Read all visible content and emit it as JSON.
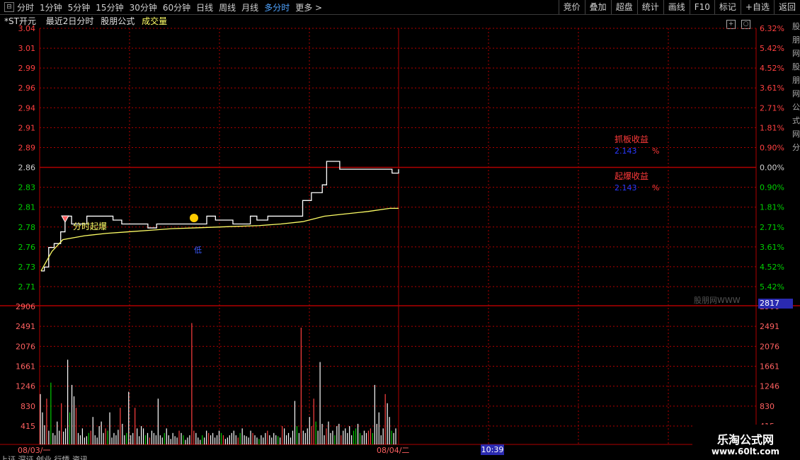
{
  "toolbar": {
    "close_glyph": "⊟",
    "tabs": [
      "分时",
      "1分钟",
      "5分钟",
      "15分钟",
      "30分钟",
      "60分钟",
      "日线",
      "周线",
      "月线",
      "多分时",
      "更多 >"
    ],
    "active_tab": "多分时",
    "right_buttons": [
      "竞价",
      "叠加",
      "超盘",
      "统计",
      "画线",
      "F10",
      "标记",
      "+自选",
      "返回"
    ]
  },
  "info": {
    "stock": "*ST开元",
    "period": "最近2日分时",
    "formula": "股朋公式",
    "volume_label": "成交量"
  },
  "price_axis": {
    "left": [
      "3.04",
      "3.01",
      "2.99",
      "2.96",
      "2.94",
      "2.91",
      "2.89",
      "2.86",
      "2.83",
      "2.81",
      "2.78",
      "2.76",
      "2.73",
      "2.71"
    ],
    "right": [
      "6.32%",
      "5.42%",
      "4.52%",
      "3.61%",
      "2.71%",
      "1.81%",
      "0.90%",
      "0.00%",
      "0.90%",
      "1.81%",
      "2.71%",
      "3.61%",
      "4.52%",
      "5.42%"
    ]
  },
  "volume_axis": {
    "labels": [
      "2906",
      "2491",
      "2076",
      "1661",
      "1246",
      "830",
      "415"
    ],
    "current": "2817"
  },
  "dates": [
    "08/03/一",
    "08/04/二"
  ],
  "time_cursor": "10:39",
  "annotations": {
    "signal": "分时起爆",
    "blue_mark": "低",
    "gain1_label": "抓板收益",
    "gain1_value": "2.143",
    "gain1_unit": "%",
    "gain2_label": "起爆收益",
    "gain2_value": "2.143",
    "gain2_unit": "%",
    "faint_text": "股朋网WWW"
  },
  "side_strip_text": "股朋网股朋网公式网分",
  "watermark": {
    "title": "乐淘公式网",
    "url": "www.60lt.com"
  },
  "status_text": "上证 深证 创业 行情 资讯",
  "colors": {
    "grid": "#b00000",
    "price_up": "#ff3a3a",
    "line_price": "#ffffff",
    "line_avg": "#ffff66",
    "vol_green": "#00cc00"
  },
  "chart_data": {
    "type": "line",
    "title": "",
    "price_series": [
      {
        "name": "",
        "points": [
          [
            0,
            2.73
          ],
          [
            3,
            2.735
          ],
          [
            7,
            2.76
          ],
          [
            12,
            2.765
          ],
          [
            18,
            2.78
          ],
          [
            22,
            2.8
          ],
          [
            28,
            2.79
          ],
          [
            35,
            2.79
          ],
          [
            42,
            2.8
          ],
          [
            50,
            2.8
          ],
          [
            58,
            2.8
          ],
          [
            66,
            2.795
          ],
          [
            74,
            2.79
          ],
          [
            82,
            2.79
          ],
          [
            90,
            2.79
          ],
          [
            98,
            2.785
          ],
          [
            106,
            2.79
          ],
          [
            114,
            2.79
          ],
          [
            124,
            2.79
          ],
          [
            134,
            2.79
          ],
          [
            144,
            2.79
          ],
          [
            152,
            2.8
          ],
          [
            160,
            2.795
          ],
          [
            168,
            2.795
          ],
          [
            176,
            2.79
          ],
          [
            184,
            2.79
          ],
          [
            192,
            2.8
          ],
          [
            198,
            2.795
          ],
          [
            204,
            2.795
          ],
          [
            208,
            2.8
          ],
          [
            214,
            2.8
          ],
          [
            222,
            2.8
          ],
          [
            230,
            2.8
          ],
          [
            240,
            2.82
          ],
          [
            248,
            2.83
          ],
          [
            253,
            2.83
          ],
          [
            258,
            2.84
          ],
          [
            262,
            2.87
          ],
          [
            268,
            2.87
          ],
          [
            274,
            2.86
          ],
          [
            282,
            2.86
          ],
          [
            290,
            2.86
          ],
          [
            298,
            2.86
          ],
          [
            308,
            2.86
          ],
          [
            316,
            2.86
          ],
          [
            322,
            2.855
          ],
          [
            328,
            2.86
          ]
        ]
      },
      {
        "name": "",
        "points": [
          [
            0,
            2.73
          ],
          [
            10,
            2.755
          ],
          [
            20,
            2.77
          ],
          [
            40,
            2.775
          ],
          [
            60,
            2.778
          ],
          [
            80,
            2.78
          ],
          [
            100,
            2.782
          ],
          [
            120,
            2.784
          ],
          [
            140,
            2.785
          ],
          [
            160,
            2.786
          ],
          [
            180,
            2.787
          ],
          [
            200,
            2.788
          ],
          [
            220,
            2.79
          ],
          [
            240,
            2.793
          ],
          [
            260,
            2.8
          ],
          [
            280,
            2.803
          ],
          [
            300,
            2.806
          ],
          [
            320,
            2.81
          ],
          [
            328,
            2.81
          ]
        ]
      }
    ],
    "volume": [
      1100,
      700,
      420,
      1000,
      300,
      1350,
      250,
      200,
      500,
      300,
      900,
      280,
      350,
      1850,
      700,
      1300,
      1050,
      800,
      250,
      200,
      350,
      150,
      180,
      250,
      300,
      600,
      200,
      150,
      400,
      500,
      250,
      350,
      300,
      700,
      150,
      250,
      200,
      320,
      800,
      450,
      200,
      250,
      1150,
      200,
      250,
      800,
      350,
      180,
      400,
      350,
      200,
      250,
      150,
      300,
      250,
      200,
      1000,
      200,
      150,
      250,
      350,
      200,
      120,
      250,
      180,
      150,
      300,
      250,
      200,
      100,
      150,
      200,
      2650,
      300,
      250,
      150,
      100,
      200,
      150,
      300,
      250,
      200,
      250,
      150,
      200,
      300,
      250,
      200,
      120,
      150,
      200,
      250,
      300,
      200,
      150,
      250,
      350,
      200,
      180,
      150,
      300,
      250,
      200,
      150,
      120,
      200,
      150,
      250,
      300,
      200,
      150,
      250,
      200,
      180,
      150,
      400,
      350,
      200,
      250,
      150,
      300,
      950,
      400,
      250,
      2550,
      300,
      250,
      350,
      600,
      400,
      1000,
      500,
      300,
      1800,
      450,
      200,
      350,
      500,
      250,
      300,
      200,
      400,
      450,
      200,
      300,
      350,
      250,
      400,
      200,
      300,
      350,
      450,
      250,
      200,
      300,
      250,
      300,
      350,
      250,
      1300,
      450,
      700,
      200,
      350,
      1100,
      900,
      600,
      300,
      250,
      350
    ],
    "xlabels": [
      "08/03/一",
      "08/04/二"
    ],
    "ylim_price": [
      2.71,
      3.04
    ],
    "ylim_volume": [
      0,
      2906
    ]
  }
}
